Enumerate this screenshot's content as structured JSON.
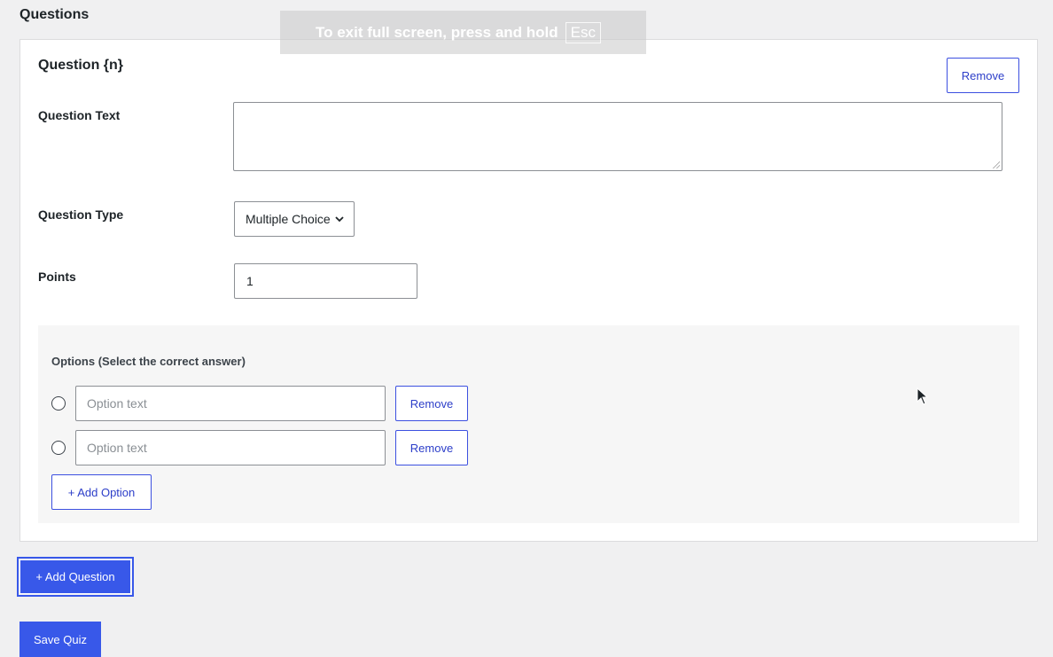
{
  "section_title": "Questions",
  "fullscreen_notice": {
    "text": "To exit full screen, press and hold",
    "key": "Esc"
  },
  "question": {
    "title": "Question {n}",
    "remove_label": "Remove",
    "text_label": "Question Text",
    "text_value": "",
    "type_label": "Question Type",
    "type_value": "Multiple Choice",
    "points_label": "Points",
    "points_value": "1",
    "options": {
      "heading": "Options (Select the correct answer)",
      "items": [
        {
          "placeholder": "Option text",
          "remove_label": "Remove"
        },
        {
          "placeholder": "Option text",
          "remove_label": "Remove"
        }
      ],
      "add_option_label": "+ Add Option"
    }
  },
  "add_question_label": "+ Add Question",
  "save_quiz_label": "Save Quiz",
  "colors": {
    "accent": "#3858e9",
    "background": "#f0f0f1"
  }
}
